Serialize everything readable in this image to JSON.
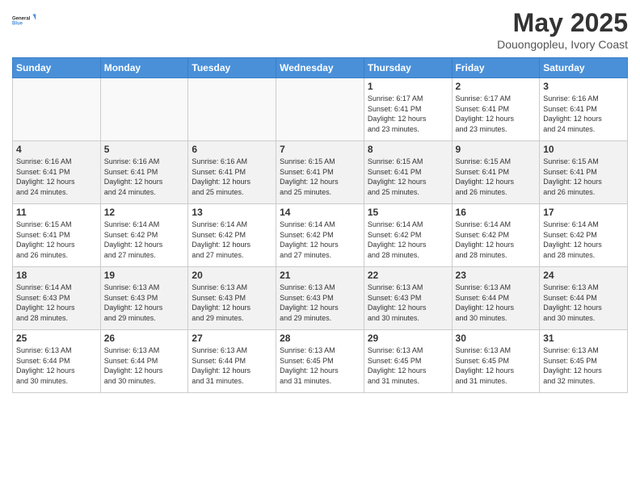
{
  "logo": {
    "line1": "General",
    "line2": "Blue"
  },
  "title": "May 2025",
  "subtitle": "Douongopleu, Ivory Coast",
  "weekdays": [
    "Sunday",
    "Monday",
    "Tuesday",
    "Wednesday",
    "Thursday",
    "Friday",
    "Saturday"
  ],
  "weeks": [
    [
      {
        "day": "",
        "info": ""
      },
      {
        "day": "",
        "info": ""
      },
      {
        "day": "",
        "info": ""
      },
      {
        "day": "",
        "info": ""
      },
      {
        "day": "1",
        "info": "Sunrise: 6:17 AM\nSunset: 6:41 PM\nDaylight: 12 hours\nand 23 minutes."
      },
      {
        "day": "2",
        "info": "Sunrise: 6:17 AM\nSunset: 6:41 PM\nDaylight: 12 hours\nand 23 minutes."
      },
      {
        "day": "3",
        "info": "Sunrise: 6:16 AM\nSunset: 6:41 PM\nDaylight: 12 hours\nand 24 minutes."
      }
    ],
    [
      {
        "day": "4",
        "info": "Sunrise: 6:16 AM\nSunset: 6:41 PM\nDaylight: 12 hours\nand 24 minutes."
      },
      {
        "day": "5",
        "info": "Sunrise: 6:16 AM\nSunset: 6:41 PM\nDaylight: 12 hours\nand 24 minutes."
      },
      {
        "day": "6",
        "info": "Sunrise: 6:16 AM\nSunset: 6:41 PM\nDaylight: 12 hours\nand 25 minutes."
      },
      {
        "day": "7",
        "info": "Sunrise: 6:15 AM\nSunset: 6:41 PM\nDaylight: 12 hours\nand 25 minutes."
      },
      {
        "day": "8",
        "info": "Sunrise: 6:15 AM\nSunset: 6:41 PM\nDaylight: 12 hours\nand 25 minutes."
      },
      {
        "day": "9",
        "info": "Sunrise: 6:15 AM\nSunset: 6:41 PM\nDaylight: 12 hours\nand 26 minutes."
      },
      {
        "day": "10",
        "info": "Sunrise: 6:15 AM\nSunset: 6:41 PM\nDaylight: 12 hours\nand 26 minutes."
      }
    ],
    [
      {
        "day": "11",
        "info": "Sunrise: 6:15 AM\nSunset: 6:41 PM\nDaylight: 12 hours\nand 26 minutes."
      },
      {
        "day": "12",
        "info": "Sunrise: 6:14 AM\nSunset: 6:42 PM\nDaylight: 12 hours\nand 27 minutes."
      },
      {
        "day": "13",
        "info": "Sunrise: 6:14 AM\nSunset: 6:42 PM\nDaylight: 12 hours\nand 27 minutes."
      },
      {
        "day": "14",
        "info": "Sunrise: 6:14 AM\nSunset: 6:42 PM\nDaylight: 12 hours\nand 27 minutes."
      },
      {
        "day": "15",
        "info": "Sunrise: 6:14 AM\nSunset: 6:42 PM\nDaylight: 12 hours\nand 28 minutes."
      },
      {
        "day": "16",
        "info": "Sunrise: 6:14 AM\nSunset: 6:42 PM\nDaylight: 12 hours\nand 28 minutes."
      },
      {
        "day": "17",
        "info": "Sunrise: 6:14 AM\nSunset: 6:42 PM\nDaylight: 12 hours\nand 28 minutes."
      }
    ],
    [
      {
        "day": "18",
        "info": "Sunrise: 6:14 AM\nSunset: 6:43 PM\nDaylight: 12 hours\nand 28 minutes."
      },
      {
        "day": "19",
        "info": "Sunrise: 6:13 AM\nSunset: 6:43 PM\nDaylight: 12 hours\nand 29 minutes."
      },
      {
        "day": "20",
        "info": "Sunrise: 6:13 AM\nSunset: 6:43 PM\nDaylight: 12 hours\nand 29 minutes."
      },
      {
        "day": "21",
        "info": "Sunrise: 6:13 AM\nSunset: 6:43 PM\nDaylight: 12 hours\nand 29 minutes."
      },
      {
        "day": "22",
        "info": "Sunrise: 6:13 AM\nSunset: 6:43 PM\nDaylight: 12 hours\nand 30 minutes."
      },
      {
        "day": "23",
        "info": "Sunrise: 6:13 AM\nSunset: 6:44 PM\nDaylight: 12 hours\nand 30 minutes."
      },
      {
        "day": "24",
        "info": "Sunrise: 6:13 AM\nSunset: 6:44 PM\nDaylight: 12 hours\nand 30 minutes."
      }
    ],
    [
      {
        "day": "25",
        "info": "Sunrise: 6:13 AM\nSunset: 6:44 PM\nDaylight: 12 hours\nand 30 minutes."
      },
      {
        "day": "26",
        "info": "Sunrise: 6:13 AM\nSunset: 6:44 PM\nDaylight: 12 hours\nand 30 minutes."
      },
      {
        "day": "27",
        "info": "Sunrise: 6:13 AM\nSunset: 6:44 PM\nDaylight: 12 hours\nand 31 minutes."
      },
      {
        "day": "28",
        "info": "Sunrise: 6:13 AM\nSunset: 6:45 PM\nDaylight: 12 hours\nand 31 minutes."
      },
      {
        "day": "29",
        "info": "Sunrise: 6:13 AM\nSunset: 6:45 PM\nDaylight: 12 hours\nand 31 minutes."
      },
      {
        "day": "30",
        "info": "Sunrise: 6:13 AM\nSunset: 6:45 PM\nDaylight: 12 hours\nand 31 minutes."
      },
      {
        "day": "31",
        "info": "Sunrise: 6:13 AM\nSunset: 6:45 PM\nDaylight: 12 hours\nand 32 minutes."
      }
    ]
  ]
}
